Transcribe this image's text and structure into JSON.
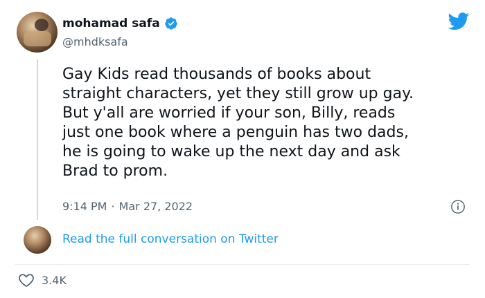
{
  "author": {
    "display_name": "mohamad safa",
    "handle": "@mhdksafa",
    "verified": true
  },
  "tweet": {
    "text": "Gay Kids read thousands of books about\nstraight characters, yet they still grow up gay.\nBut y'all are worried if your son, Billy, reads\njust one book where a penguin has two dads,\nhe is going to wake up the next day and ask\nBrad to prom.",
    "time": "9:14 PM",
    "separator": "·",
    "date": "Mar 27, 2022"
  },
  "conversation_link": "Read the full conversation on Twitter",
  "likes": "3.4K",
  "colors": {
    "accent": "#1d9bf0",
    "text": "#0f1419",
    "secondary": "#536471",
    "line": "#cfd9de"
  },
  "icons": {
    "brand": "twitter-bird-icon",
    "verified": "verified-badge-icon",
    "info": "info-icon",
    "like": "heart-icon"
  }
}
